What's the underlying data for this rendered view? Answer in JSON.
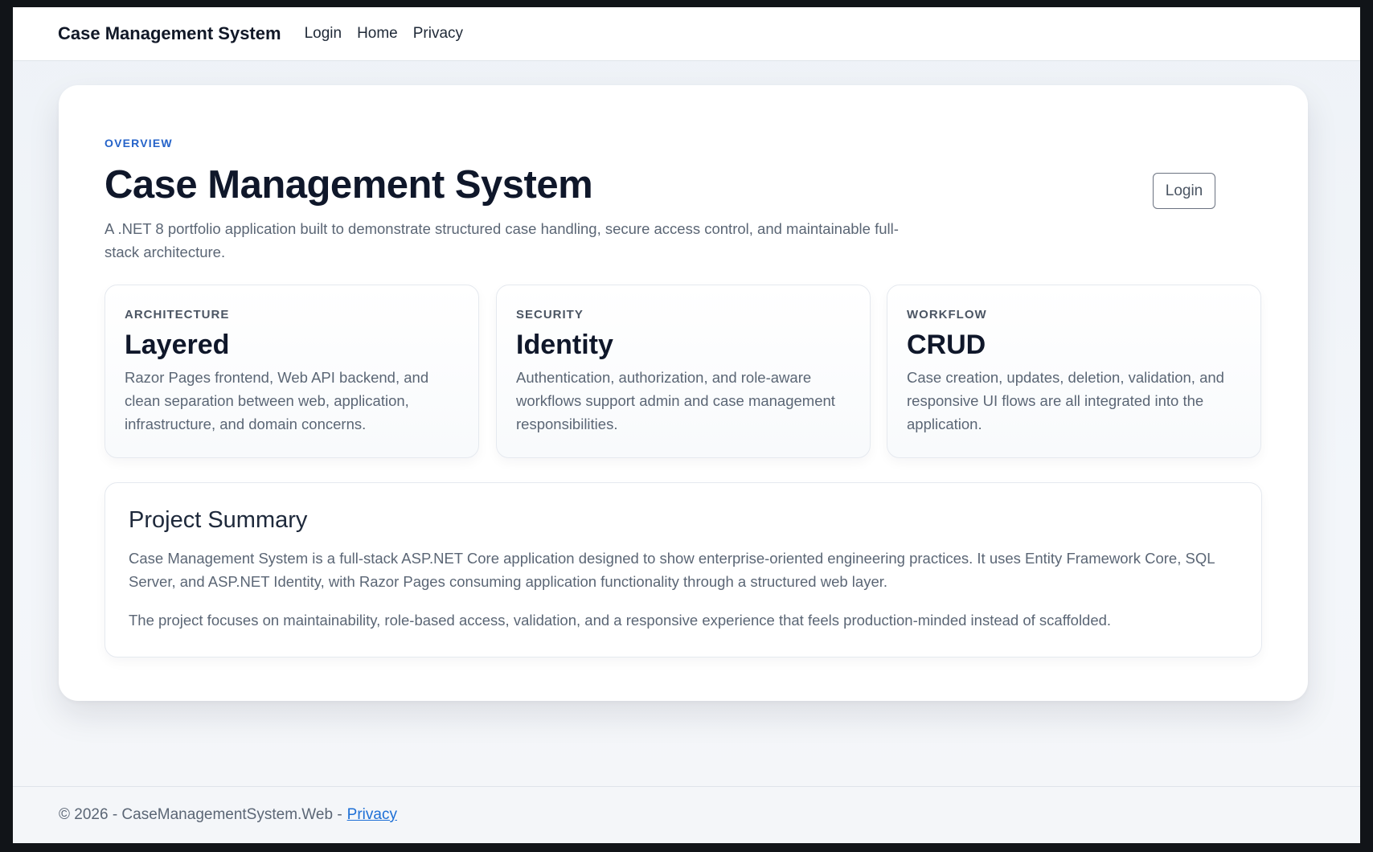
{
  "navbar": {
    "brand": "Case Management System",
    "links": [
      "Login",
      "Home",
      "Privacy"
    ]
  },
  "hero": {
    "eyebrow": "OVERVIEW",
    "title": "Case Management System",
    "lead": "A .NET 8 portfolio application built to demonstrate structured case handling, secure access control, and maintainable full-stack architecture.",
    "login_button": "Login"
  },
  "features": [
    {
      "eyebrow": "ARCHITECTURE",
      "title": "Layered",
      "text": "Razor Pages frontend, Web API backend, and clean separation between web, application, infrastructure, and domain concerns."
    },
    {
      "eyebrow": "SECURITY",
      "title": "Identity",
      "text": "Authentication, authorization, and role-aware workflows support admin and case management responsibilities."
    },
    {
      "eyebrow": "WORKFLOW",
      "title": "CRUD",
      "text": "Case creation, updates, deletion, validation, and responsive UI flows are all integrated into the application."
    }
  ],
  "summary": {
    "title": "Project Summary",
    "paragraphs": [
      "Case Management System is a full-stack ASP.NET Core application designed to show enterprise-oriented engineering practices. It uses Entity Framework Core, SQL Server, and ASP.NET Identity, with Razor Pages consuming application functionality through a structured web layer.",
      "The project focuses on maintainability, role-based access, validation, and a responsive experience that feels production-minded instead of scaffolded."
    ]
  },
  "footer": {
    "text": "© 2026 - CaseManagementSystem.Web -",
    "privacy_link": "Privacy"
  },
  "colors": {
    "accent": "#2563c9",
    "link": "#1d6fd6",
    "heading": "#0f172a",
    "body_text": "#5b6675"
  }
}
